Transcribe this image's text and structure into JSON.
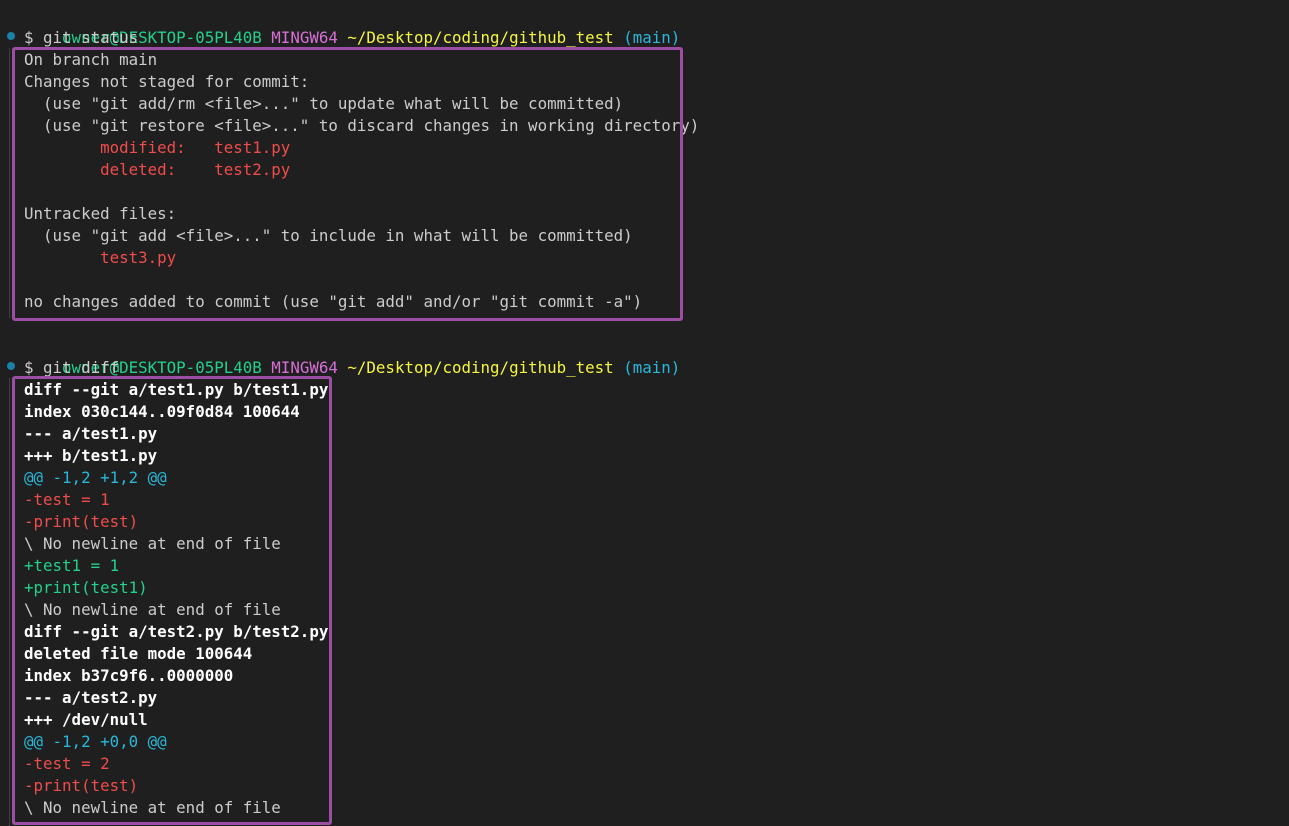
{
  "blocks": [
    {
      "prompt": {
        "user_host": "owner@DESKTOP-05PL40B",
        "shell": "MINGW64",
        "path": "~/Desktop/coding/github_test",
        "branch": "(main)"
      },
      "command": "$ git status",
      "output": [
        "On branch main",
        "Changes not staged for commit:",
        "  (use \"git add/rm <file>...\" to update what will be committed)",
        "  (use \"git restore <file>...\" to discard changes in working directory)",
        "        modified:   test1.py",
        "        deleted:    test2.py",
        "",
        "Untracked files:",
        "  (use \"git add <file>...\" to include in what will be committed)",
        "        test3.py",
        "",
        "no changes added to commit (use \"git add\" and/or \"git commit -a\")"
      ]
    },
    {
      "prompt": {
        "user_host": "owner@DESKTOP-05PL40B",
        "shell": "MINGW64",
        "path": "~/Desktop/coding/github_test",
        "branch": "(main)"
      },
      "command": "$ git diff",
      "output": [
        "diff --git a/test1.py b/test1.py",
        "index 030c144..09f0d84 100644",
        "--- a/test1.py",
        "+++ b/test1.py",
        "@@ -1,2 +1,2 @@",
        "-test = 1",
        "-print(test)",
        "\\ No newline at end of file",
        "+test1 = 1",
        "+print(test1)",
        "\\ No newline at end of file",
        "diff --git a/test2.py b/test2.py",
        "deleted file mode 100644",
        "index b37c9f6..0000000",
        "--- a/test2.py",
        "+++ /dev/null",
        "@@ -1,2 +0,0 @@",
        "-test = 2",
        "-print(test)",
        "\\ No newline at end of file"
      ]
    }
  ],
  "colors": {
    "background": "#1f1f1f",
    "text": "#cccccc",
    "user_host": "#23d18b",
    "shell": "#d670d6",
    "path": "#f5f543",
    "branch": "#29b8db",
    "removed": "#f14c4c",
    "added": "#23d18b",
    "hunk": "#29b8db",
    "highlight_border": "#9b4ea3",
    "command_marker": "#1b81a8"
  }
}
